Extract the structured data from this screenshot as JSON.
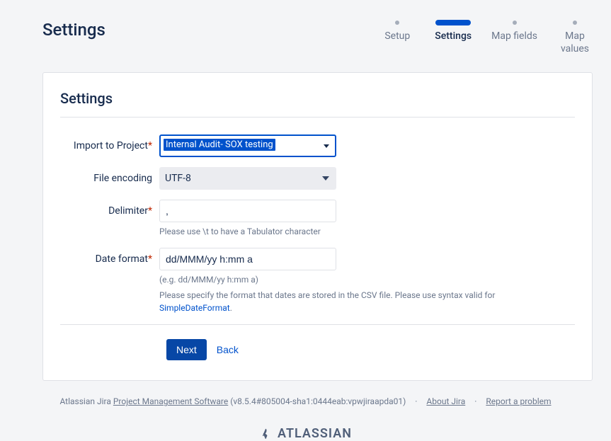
{
  "page_title": "Settings",
  "steps": [
    {
      "label": "Setup",
      "state": "done"
    },
    {
      "label": "Settings",
      "state": "active"
    },
    {
      "label": "Map fields",
      "state": "pending"
    },
    {
      "label": "Map values",
      "state": "pending"
    }
  ],
  "card_title": "Settings",
  "form": {
    "import_project": {
      "label": "Import to Project",
      "value": "Internal Audit- SOX testing"
    },
    "file_encoding": {
      "label": "File encoding",
      "value": "UTF-8"
    },
    "delimiter": {
      "label": "Delimiter",
      "value": ",",
      "help": "Please use \\t to have a Tabulator character"
    },
    "date_format": {
      "label": "Date format",
      "value": "dd/MMM/yy h:mm a",
      "example": "(e.g. dd/MMM/yy h:mm a)",
      "help": "Please specify the format that dates are stored in the CSV file. Please use syntax valid for ",
      "help_link_text": "SimpleDateFormat",
      "help_suffix": "."
    }
  },
  "actions": {
    "next": "Next",
    "back": "Back"
  },
  "footer": {
    "prefix": "Atlassian Jira ",
    "pm_link": "Project Management Software",
    "version": " (v8.5.4#805004-sha1:0444eab:vpwjiraapda01)",
    "about": "About Jira",
    "report": "Report a problem",
    "logo_text": "ATLASSIAN"
  }
}
